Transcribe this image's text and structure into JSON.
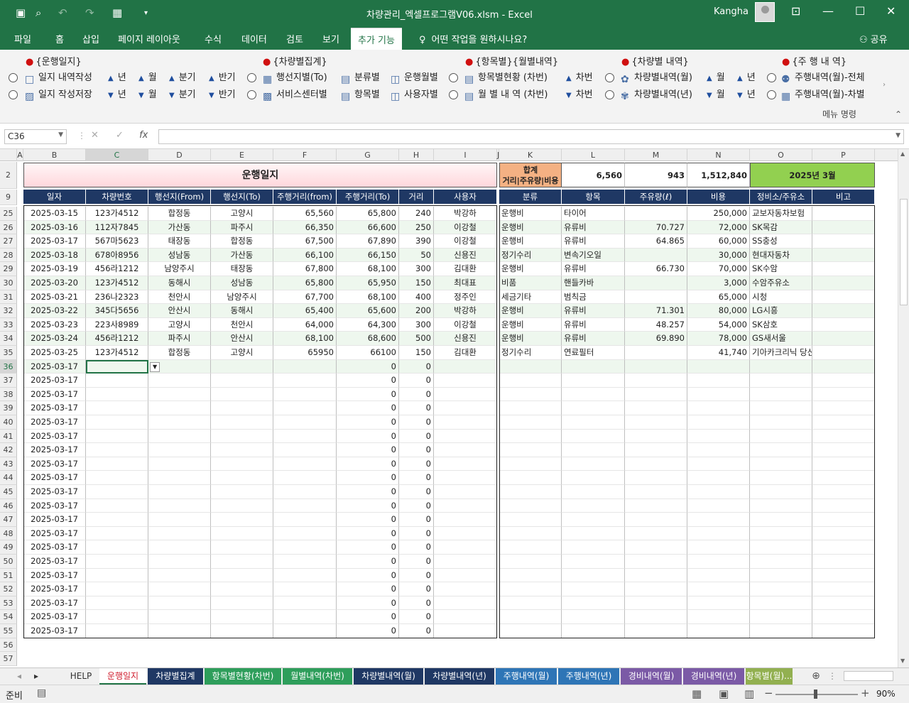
{
  "titlebar": {
    "filename": "차량관리_엑셀프로그램V06.xlsm",
    "separator": "-",
    "app": "Excel",
    "user": "Kangha"
  },
  "tabs": [
    "파일",
    "홈",
    "삽입",
    "페이지 레이아웃",
    "수식",
    "데이터",
    "검토",
    "보기",
    "추가 기능"
  ],
  "active_tab": "추가 기능",
  "tell_me": "어떤 작업을 원하시나요?",
  "share": "공유",
  "ribbon": {
    "groups": [
      "{운행일지}",
      "{차량별집계}",
      "{항목별}{월별내역}",
      "{차량별 내역}",
      "{주 행 내 역}"
    ],
    "row1": [
      "일지 내역작성",
      "년",
      "월",
      "분기",
      "반기",
      "행선지별(To)",
      "분류별",
      "운행월별",
      "항목별현황 (차번)",
      "차번",
      "차량별내역(월)",
      "월",
      "년",
      "주행내역(월)-전체"
    ],
    "row2": [
      "일지 작성저장",
      "년",
      "월",
      "분기",
      "반기",
      "서비스센터별",
      "항목별",
      "사용자별",
      "월 별 내 역 (차번)",
      "차번",
      "차량별내역(년)",
      "월",
      "년",
      "주행내역(월)-차별"
    ],
    "footer": "메뉴 명령"
  },
  "formula": {
    "namebox": "C36",
    "fx": "fx"
  },
  "columns": [
    "A",
    "B",
    "C",
    "D",
    "E",
    "F",
    "G",
    "H",
    "I",
    "J",
    "K",
    "L",
    "M",
    "N",
    "O",
    "P"
  ],
  "sheet_title": "운행일지",
  "summary": {
    "label1": "합계",
    "label2": "거리|주유량|비용",
    "distance": "6,560",
    "fuel": "943",
    "cost": "1,512,840",
    "month": "2025년 3월"
  },
  "headers": [
    "일자",
    "차량번호",
    "행선지(From)",
    "행선지(To)",
    "주행거리(from)",
    "주행거리(To)",
    "거리",
    "사용자",
    "분류",
    "항목",
    "주유량(ℓ)",
    "비용",
    "정비소/주유소",
    "비고"
  ],
  "rows": [
    [
      "25",
      "2025-03-15",
      "123가4512",
      "합정동",
      "고양시",
      "65,560",
      "65,800",
      "240",
      "박강하",
      "운행비",
      "타이어",
      "",
      "250,000",
      "교보자동차보험"
    ],
    [
      "26",
      "2025-03-16",
      "112자7845",
      "가산동",
      "파주시",
      "66,350",
      "66,600",
      "250",
      "이강철",
      "운행비",
      "유류비",
      "70.727",
      "72,000",
      "SK목감"
    ],
    [
      "27",
      "2025-03-17",
      "567마5623",
      "태장동",
      "합정동",
      "67,500",
      "67,890",
      "390",
      "이강철",
      "운행비",
      "유류비",
      "64.865",
      "60,000",
      "SS충성"
    ],
    [
      "28",
      "2025-03-18",
      "678아8956",
      "성남동",
      "가산동",
      "66,100",
      "66,150",
      "50",
      "신용진",
      "정기수리",
      "변속기오일",
      "",
      "30,000",
      "현대자동차"
    ],
    [
      "29",
      "2025-03-19",
      "456라1212",
      "남양주시",
      "태장동",
      "67,800",
      "68,100",
      "300",
      "김대환",
      "운행비",
      "유류비",
      "66.730",
      "70,000",
      "SK수암"
    ],
    [
      "30",
      "2025-03-20",
      "123가4512",
      "동해시",
      "성남동",
      "65,800",
      "65,950",
      "150",
      "최대표",
      "비품",
      "핸들카바",
      "",
      "3,000",
      "수암주유소"
    ],
    [
      "31",
      "2025-03-21",
      "236나2323",
      "천안시",
      "남양주시",
      "67,700",
      "68,100",
      "400",
      "정주인",
      "세금기타",
      "범칙금",
      "",
      "65,000",
      "시청"
    ],
    [
      "32",
      "2025-03-22",
      "345다5656",
      "안산시",
      "동해시",
      "65,400",
      "65,600",
      "200",
      "박강하",
      "운행비",
      "유류비",
      "71.301",
      "80,000",
      "LG시흥"
    ],
    [
      "33",
      "2025-03-23",
      "223사8989",
      "고양시",
      "천안시",
      "64,000",
      "64,300",
      "300",
      "이강철",
      "운행비",
      "유류비",
      "48.257",
      "54,000",
      "SK삼호"
    ],
    [
      "34",
      "2025-03-24",
      "456라1212",
      "파주시",
      "안산시",
      "68,100",
      "68,600",
      "500",
      "신용진",
      "운행비",
      "유류비",
      "69.890",
      "78,000",
      "GS새서울"
    ],
    [
      "35",
      "2025-03-25",
      "123가4512",
      "합정동",
      "고양시",
      "65950",
      "66100",
      "150",
      "김대환",
      "정기수리",
      "연료필터",
      "",
      "41,740",
      "기아카크리닉 당산점"
    ]
  ],
  "empty_date": "2025-03-17",
  "zero": "0",
  "empty_rows": [
    "36",
    "37",
    "38",
    "39",
    "40",
    "41",
    "42",
    "43",
    "44",
    "45",
    "46",
    "47",
    "48",
    "49",
    "50",
    "51",
    "52",
    "53",
    "54",
    "55"
  ],
  "tail_rows": [
    "56",
    "57"
  ],
  "sheet_tabs": [
    {
      "label": "HELP",
      "bg": "#f0f0f0",
      "fg": "#333"
    },
    {
      "label": "운행일지",
      "bg": "#ffffff",
      "fg": "#d02030"
    },
    {
      "label": "차량별집계",
      "bg": "#1f3864",
      "fg": "#ffffff"
    },
    {
      "label": "항목별현황(차번)",
      "bg": "#2e9e5b",
      "fg": "#ffffff"
    },
    {
      "label": "월별내역(차번)",
      "bg": "#2e9e5b",
      "fg": "#ffffff"
    },
    {
      "label": "차량별내역(월)",
      "bg": "#1f3864",
      "fg": "#ffffff"
    },
    {
      "label": "차량별내역(년)",
      "bg": "#1f3864",
      "fg": "#ffffff"
    },
    {
      "label": "주행내역(월)",
      "bg": "#2e75b6",
      "fg": "#ffffff"
    },
    {
      "label": "주행내역(년)",
      "bg": "#2e75b6",
      "fg": "#ffffff"
    },
    {
      "label": "경비내역(월)",
      "bg": "#7b5aa6",
      "fg": "#ffffff"
    },
    {
      "label": "경비내역(년)",
      "bg": "#7b5aa6",
      "fg": "#ffffff"
    },
    {
      "label": "항목별(월)...",
      "bg": "#92b050",
      "fg": "#ffffff"
    }
  ],
  "status": {
    "ready": "준비",
    "zoom": "90%"
  },
  "colors": {
    "excel_green": "#217346",
    "header_navy": "#1f3864",
    "title_pink": "#ffd7dc",
    "summary_orange": "#f4b183",
    "month_green": "#92d050"
  }
}
